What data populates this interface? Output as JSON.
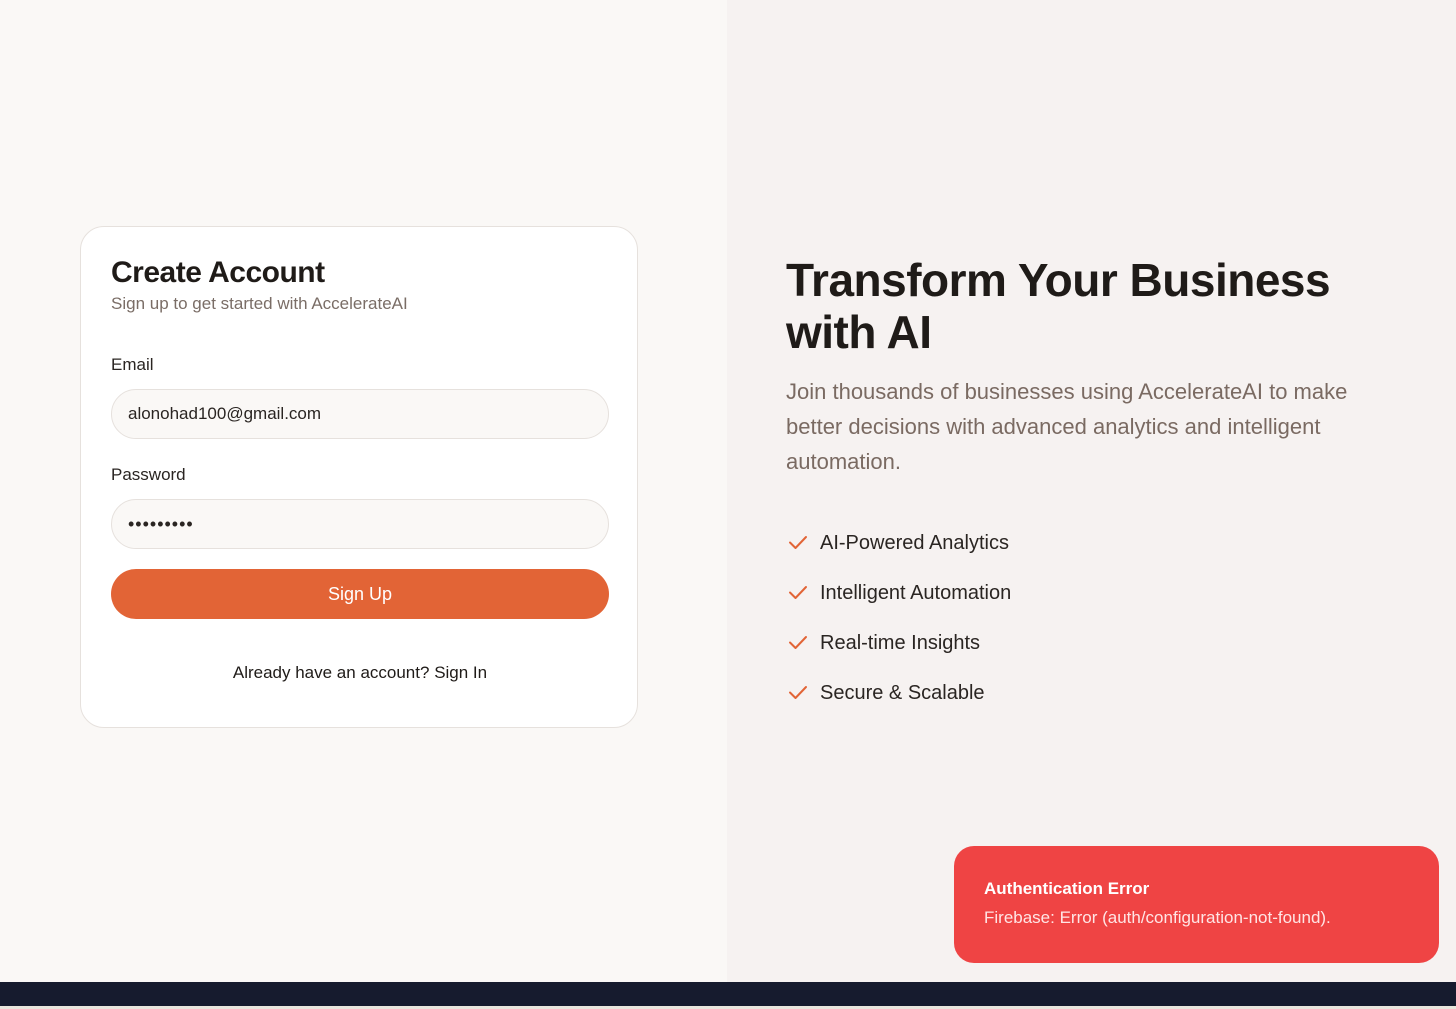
{
  "signup_card": {
    "title": "Create Account",
    "subtitle": "Sign up to get started with AccelerateAI",
    "email_label": "Email",
    "email_value": "alonohad100@gmail.com",
    "password_label": "Password",
    "password_value": "•••••••••",
    "signup_button": "Sign Up",
    "signin_prompt": "Already have an account?",
    "signin_link": "Sign In"
  },
  "hero": {
    "title": "Transform Your Business with AI",
    "description": "Join thousands of businesses using AccelerateAI to make better decisions with advanced analytics and intelligent automation.",
    "features": [
      "AI-Powered Analytics",
      "Intelligent Automation",
      "Real-time Insights",
      "Secure & Scalable"
    ]
  },
  "toast": {
    "title": "Authentication Error",
    "message": "Firebase: Error (auth/configuration-not-found)."
  },
  "colors": {
    "accent": "#e26436",
    "error": "#ef4444",
    "check": "#e26436"
  },
  "icons": {
    "feature_icon": "check-icon"
  }
}
